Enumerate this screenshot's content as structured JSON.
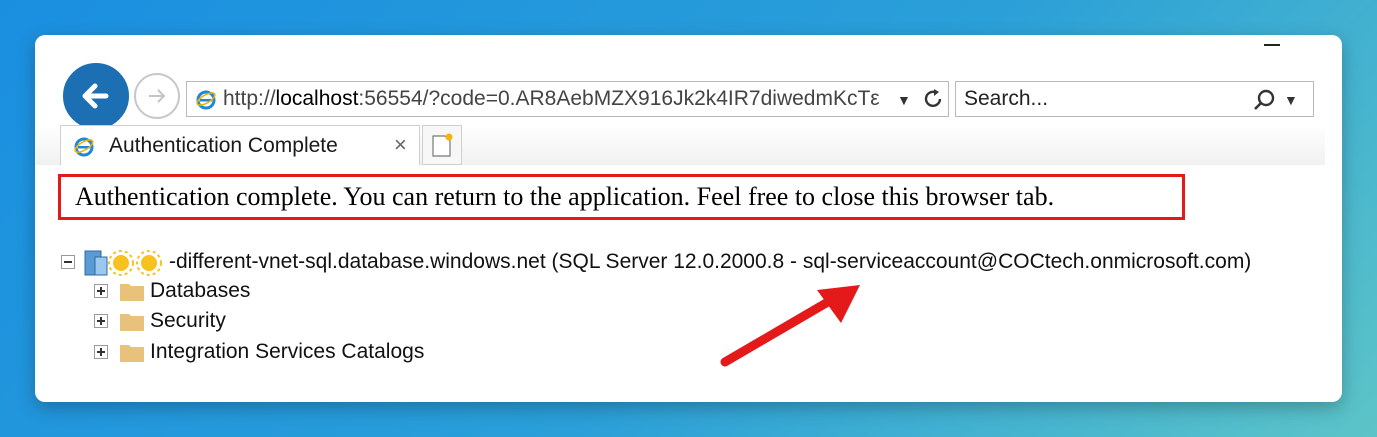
{
  "browser": {
    "url_prefix": "http://",
    "url_host": "localhost",
    "url_rest": ":56554/?code=0.AR8AebMZX916Jk2k4IR7diwedmKcTε",
    "search_placeholder": "Search...",
    "tab_title": "Authentication Complete",
    "tab_close": "×"
  },
  "content": {
    "auth_message": "Authentication complete. You can return to the application. Feel free to close this browser tab."
  },
  "tree": {
    "server_label": "-different-vnet-sql.database.windows.net (SQL Server 12.0.2000.8 - sql-serviceaccount@COCtech.onmicrosoft.com)",
    "children": [
      {
        "label": "Databases"
      },
      {
        "label": "Security"
      },
      {
        "label": "Integration Services Catalogs"
      }
    ]
  },
  "colors": {
    "accent": "#1c6fb3",
    "highlight_border": "#e41919",
    "arrow": "#e41919",
    "folder": "#e8c27a"
  },
  "icons": [
    "back-arrow-icon",
    "forward-arrow-icon",
    "ie-icon",
    "dropdown-icon",
    "refresh-icon",
    "search-icon",
    "new-tab-icon",
    "server-icon",
    "folder-icon",
    "annotation-arrow"
  ]
}
